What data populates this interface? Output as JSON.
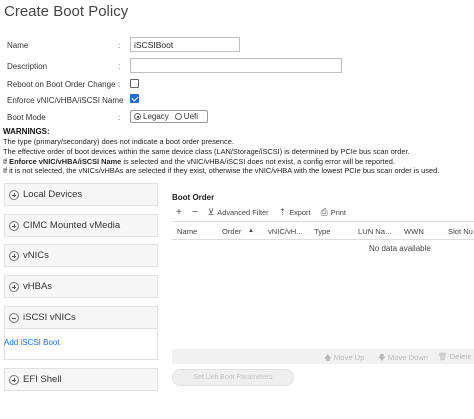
{
  "title": "Create Boot Policy",
  "form": {
    "name_label": "Name",
    "name_value": "iSCSIBoot",
    "description_label": "Description",
    "description_value": "",
    "reboot_label": "Reboot on Boot Order Change",
    "reboot_checked": false,
    "enforce_label": "Enforce vNIC/vHBA/iSCSI Name",
    "enforce_checked": true,
    "boot_mode_label": "Boot Mode",
    "boot_mode_options": [
      "Legacy",
      "Uefi"
    ],
    "boot_mode_selected": "Legacy",
    "colon": ":"
  },
  "warnings": {
    "heading": "WARNINGS:",
    "line1": "The type (primary/secondary) does not indicate a boot order presence.",
    "line2": "The effective order of boot devices within the same device class (LAN/Storage/iSCSI) is determined by PCIe bus scan order.",
    "line3_pre": "If ",
    "line3_bold": "Enforce vNIC/vHBA/iSCSI Name",
    "line3_post": " is selected and the vNIC/vHBA/iSCSI does not exist, a config error will be reported.",
    "line4": "If it is not selected, the vNICs/vHBAs are selected if they exist, otherwise the vNIC/vHBA with the lowest PCIe bus scan order is used."
  },
  "sections": {
    "local_devices": "Local Devices",
    "cimc_vmedia": "CIMC Mounted vMedia",
    "vnics": "vNICs",
    "vhbas": "vHBAs",
    "iscsi_vnics": "iSCSI vNICs",
    "add_iscsi_boot": "Add iSCSI Boot",
    "efi_shell": "EFI Shell"
  },
  "boot_order": {
    "title": "Boot Order",
    "toolbar": {
      "add": "+",
      "remove": "−",
      "advanced_filter": "Advanced Filter",
      "export": "Export",
      "print": "Print"
    },
    "columns": [
      "Name",
      "Order",
      "vNIC/vH...",
      "Type",
      "LUN Na...",
      "WWN",
      "Slot Nu"
    ],
    "sort_indicator": "▲",
    "empty_text": "No data available",
    "actions": {
      "move_up": "Move Up",
      "move_down": "Move Down",
      "delete": "Delete"
    },
    "set_button": "Set Uefi Boot Parameters"
  },
  "colors": {
    "accent": "#1f6fd0",
    "disabled": "#b9b9b9"
  }
}
